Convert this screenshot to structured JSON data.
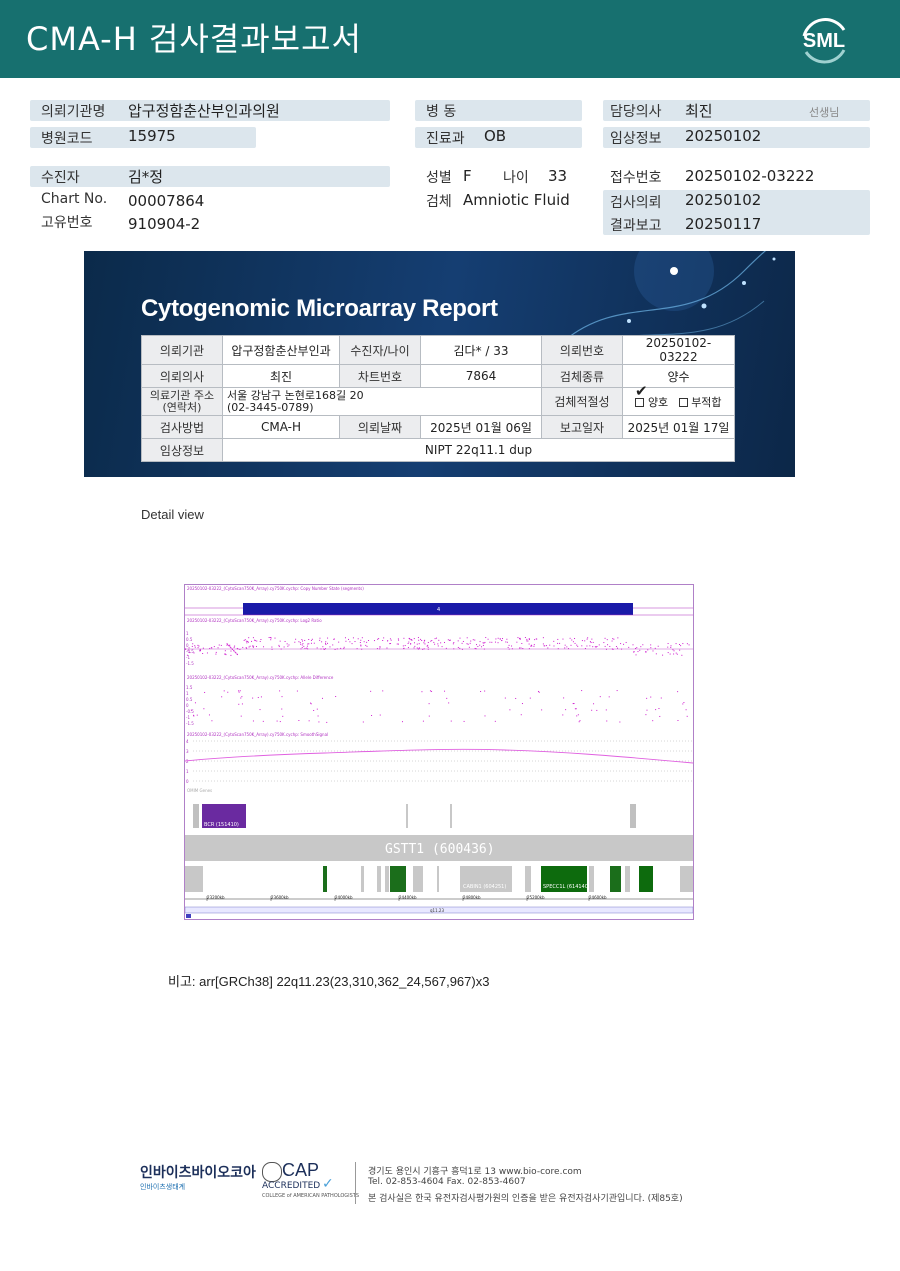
{
  "header": {
    "title": "CMA-H 검사결과보고서",
    "logo": "SML"
  },
  "info": {
    "hospital_label": "의뢰기관명",
    "hospital": "압구정함춘산부인과의원",
    "code_label": "병원코드",
    "code": "15975",
    "patient_label": "수진자",
    "patient": "김*정",
    "chart_label": "Chart No.",
    "chart": "00007864",
    "uid_label": "고유번호",
    "uid": "910904-2",
    "ward_label": "병 동",
    "ward": "",
    "dept_label": "진료과",
    "dept": "OB",
    "sex_label": "성별",
    "sex": "F",
    "age_label": "나이",
    "age": "33",
    "specimen_label": "검체",
    "specimen": "Amniotic Fluid",
    "doctor_label": "담당의사",
    "doctor": "최진",
    "doctor_suffix": "선생님",
    "clinical_label": "임상정보",
    "clinical": "20250102",
    "receipt_label": "접수번호",
    "receipt": "20250102-03222",
    "req_label": "검사의뢰",
    "req": "20250102",
    "result_label": "결과보고",
    "result": "20250117"
  },
  "report": {
    "title": "Cytogenomic Microarray Report",
    "rows": [
      [
        "의뢰기관",
        "압구정함춘산부인과",
        "수진자/나이",
        "김다* / 33",
        "의뢰번호",
        "20250102-03222"
      ],
      [
        "의뢰의사",
        "최진",
        "차트번호",
        "7864",
        "검체종류",
        "양수"
      ],
      [
        "의료기관 주소\n(연락처)",
        "서울 강남구 논현로168길 20\n(02-3445-0789)",
        "",
        "",
        "검체적절성",
        ""
      ],
      [
        "검사방법",
        "CMA-H",
        "의뢰날짜",
        "2025년 01월 06일",
        "보고일자",
        "2025년 01월 17일"
      ],
      [
        "임상정보",
        "NIPT 22q11.1 dup"
      ]
    ],
    "adequacy_ok": "양호",
    "adequacy_bad": "부적합",
    "checkmark": "✔"
  },
  "detail": {
    "label": "Detail view"
  },
  "cnv": {
    "track_titles": [
      "20250102-03222_(CytoScan750K_Array).cy750K.cychp: Copy Number State (segments)",
      "20250102-03222_(CytoScan750K_Array).cy750K.cychp: Log2 Ratio",
      "20250102-03222_(CytoScan750K_Array).cy750K.cychp: Allele Difference",
      "20250102-03222_(CytoScan750K_Array).cy750K.cychp: SmoothSignal"
    ],
    "segment_label": "4",
    "log2_ticks": [
      "1",
      "0.5",
      "0",
      "-0.5",
      "-1",
      "-1.5"
    ],
    "allele_ticks": [
      "1.5",
      "1",
      "0.5",
      "0",
      "-0.5",
      "-1",
      "-1.5"
    ],
    "smooth_ticks": [
      "4",
      "3",
      "2",
      "1",
      "0"
    ],
    "omim_genes_label": "OMIM Genes",
    "bcr_label": "BCR (151410)",
    "gstt_label": "GSTT1 (600436)",
    "cabin1_label": "CABIN1 (604251)",
    "speccl_label": "SPECC1L (614140)",
    "axis_ticks": [
      "23200kb",
      "23600kb",
      "24000kb",
      "24400kb",
      "24800kb",
      "25200kb",
      "24600kb"
    ],
    "band_label": "q11.23"
  },
  "remark": {
    "text": "비고: arr[GRCh38] 22q11.23(23,310,362_24,567,967)x3"
  },
  "footer": {
    "company": "인바이츠바이오코아",
    "company_sub": "인바이츠생태계",
    "cap": "CAP",
    "cap_sub": "ACCREDITED",
    "cap_small": "COLLEGE of AMERICAN PATHOLOGISTS",
    "address": "경기도 용인시 기흥구 흥덕1로 13   www.bio-core.com",
    "tel": "Tel. 02-853-4604   Fax. 02-853-4607",
    "note": "본 검사실은 한국 유전자검사평가원의 인증을 받은 유전자검사기관입니다. (제85호)"
  }
}
